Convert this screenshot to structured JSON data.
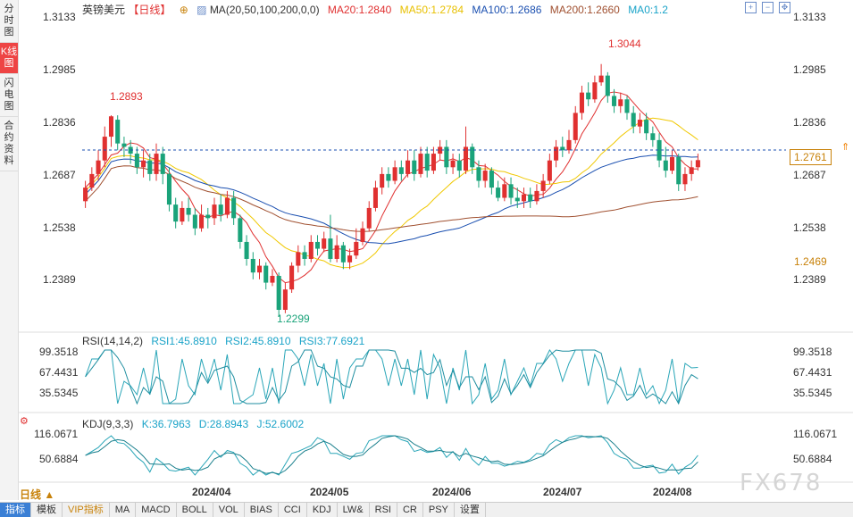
{
  "sidebar": {
    "tabs": [
      "分时图",
      "K线图",
      "闪电图",
      "合约资料"
    ],
    "active": 1
  },
  "header": {
    "symbol": "英镑美元",
    "period": "【日线】",
    "ma_def": "MA(20,50,100,200,0,0)",
    "ma20": "MA20:1.2840",
    "ma50": "MA50:1.2784",
    "ma100": "MA100:1.2686",
    "ma200": "MA200:1.2660",
    "ma0": "MA0:1.2"
  },
  "price_axis": [
    "1.3133",
    "1.2985",
    "1.2836",
    "1.2687",
    "1.2538",
    "1.2389"
  ],
  "price_boxes": {
    "current": "1.2761",
    "ma_level": "1.2469"
  },
  "annotations": {
    "high1": "1.2893",
    "high2": "1.3044",
    "low": "1.2299"
  },
  "rsi": {
    "def": "RSI(14,14,2)",
    "rsi1": "RSI1:45.8910",
    "rsi2": "RSI2:45.8910",
    "rsi3": "RSI3:77.6921",
    "axis": [
      "99.3518",
      "67.4431",
      "35.5345"
    ]
  },
  "kdj": {
    "def": "KDJ(9,3,3)",
    "k": "K:36.7963",
    "d": "D:28.8943",
    "j": "J:52.6002",
    "axis": [
      "116.0671",
      "50.6884"
    ]
  },
  "dates": [
    "2024/04",
    "2024/05",
    "2024/06",
    "2024/07",
    "2024/08"
  ],
  "period_label": "日线 ▲",
  "bottom_tabs": [
    "指标",
    "模板",
    "VIP指标",
    "MA",
    "MACD",
    "BOLL",
    "VOL",
    "BIAS",
    "CCI",
    "KDJ",
    "LW&",
    "RSI",
    "CR",
    "PSY",
    "设置"
  ],
  "watermark": "FX678",
  "colors": {
    "up": "#e03030",
    "down": "#1aa37a",
    "ma20": "#e03030",
    "ma50": "#f0c800",
    "ma100": "#1a4fb0",
    "ma200": "#a05030"
  },
  "chart_data": {
    "type": "candlestick",
    "ylim": [
      1.227,
      1.318
    ],
    "candles": [
      [
        1.264,
        1.268,
        1.262,
        1.27
      ],
      [
        1.268,
        1.272,
        1.267,
        1.274
      ],
      [
        1.272,
        1.276,
        1.27,
        1.279
      ],
      [
        1.276,
        1.283,
        1.274,
        1.286
      ],
      [
        1.283,
        1.289,
        1.28,
        1.2893
      ],
      [
        1.288,
        1.281,
        1.279,
        1.2893
      ],
      [
        1.281,
        1.28,
        1.277,
        1.283
      ],
      [
        1.28,
        1.278,
        1.275,
        1.282
      ],
      [
        1.278,
        1.274,
        1.272,
        1.28
      ],
      [
        1.274,
        1.276,
        1.271,
        1.279
      ],
      [
        1.276,
        1.272,
        1.27,
        1.278
      ],
      [
        1.272,
        1.278,
        1.27,
        1.281
      ],
      [
        1.278,
        1.272,
        1.269,
        1.28
      ],
      [
        1.272,
        1.263,
        1.261,
        1.274
      ],
      [
        1.263,
        1.258,
        1.256,
        1.265
      ],
      [
        1.258,
        1.262,
        1.257,
        1.264
      ],
      [
        1.262,
        1.26,
        1.258,
        1.265
      ],
      [
        1.26,
        1.256,
        1.254,
        1.262
      ],
      [
        1.256,
        1.26,
        1.255,
        1.263
      ],
      [
        1.26,
        1.259,
        1.256,
        1.262
      ],
      [
        1.259,
        1.263,
        1.257,
        1.265
      ],
      [
        1.263,
        1.26,
        1.258,
        1.266
      ],
      [
        1.26,
        1.265,
        1.259,
        1.267
      ],
      [
        1.265,
        1.259,
        1.257,
        1.267
      ],
      [
        1.259,
        1.252,
        1.25,
        1.26
      ],
      [
        1.252,
        1.247,
        1.245,
        1.254
      ],
      [
        1.247,
        1.243,
        1.241,
        1.249
      ],
      [
        1.243,
        1.245,
        1.241,
        1.247
      ],
      [
        1.245,
        1.24,
        1.238,
        1.246
      ],
      [
        1.24,
        1.242,
        1.239,
        1.244
      ],
      [
        1.242,
        1.232,
        1.2299,
        1.243
      ],
      [
        1.232,
        1.238,
        1.231,
        1.24
      ],
      [
        1.238,
        1.245,
        1.237,
        1.246
      ],
      [
        1.245,
        1.249,
        1.243,
        1.251
      ],
      [
        1.249,
        1.247,
        1.245,
        1.251
      ],
      [
        1.247,
        1.252,
        1.246,
        1.254
      ],
      [
        1.252,
        1.25,
        1.248,
        1.254
      ],
      [
        1.25,
        1.253,
        1.249,
        1.255
      ],
      [
        1.253,
        1.247,
        1.246,
        1.26
      ],
      [
        1.247,
        1.251,
        1.246,
        1.254
      ],
      [
        1.251,
        1.246,
        1.244,
        1.252
      ],
      [
        1.246,
        1.248,
        1.244,
        1.25
      ],
      [
        1.248,
        1.252,
        1.247,
        1.256
      ],
      [
        1.252,
        1.256,
        1.251,
        1.258
      ],
      [
        1.256,
        1.262,
        1.255,
        1.264
      ],
      [
        1.262,
        1.268,
        1.261,
        1.27
      ],
      [
        1.268,
        1.272,
        1.266,
        1.274
      ],
      [
        1.272,
        1.27,
        1.268,
        1.274
      ],
      [
        1.27,
        1.274,
        1.269,
        1.276
      ],
      [
        1.274,
        1.272,
        1.27,
        1.276
      ],
      [
        1.272,
        1.276,
        1.271,
        1.279
      ],
      [
        1.276,
        1.272,
        1.27,
        1.279
      ],
      [
        1.272,
        1.278,
        1.271,
        1.28
      ],
      [
        1.278,
        1.273,
        1.271,
        1.28
      ],
      [
        1.273,
        1.278,
        1.272,
        1.28
      ],
      [
        1.278,
        1.28,
        1.276,
        1.282
      ],
      [
        1.28,
        1.274,
        1.272,
        1.282
      ],
      [
        1.274,
        1.276,
        1.272,
        1.278
      ],
      [
        1.276,
        1.273,
        1.271,
        1.278
      ],
      [
        1.273,
        1.28,
        1.272,
        1.286
      ],
      [
        1.28,
        1.274,
        1.272,
        1.281
      ],
      [
        1.274,
        1.27,
        1.268,
        1.276
      ],
      [
        1.27,
        1.273,
        1.268,
        1.275
      ],
      [
        1.273,
        1.268,
        1.266,
        1.274
      ],
      [
        1.268,
        1.265,
        1.264,
        1.27
      ],
      [
        1.265,
        1.269,
        1.264,
        1.271
      ],
      [
        1.269,
        1.265,
        1.263,
        1.271
      ],
      [
        1.265,
        1.264,
        1.262,
        1.268
      ],
      [
        1.264,
        1.266,
        1.262,
        1.268
      ],
      [
        1.266,
        1.264,
        1.262,
        1.268
      ],
      [
        1.264,
        1.267,
        1.263,
        1.269
      ],
      [
        1.267,
        1.27,
        1.265,
        1.272
      ],
      [
        1.27,
        1.276,
        1.269,
        1.278
      ],
      [
        1.276,
        1.28,
        1.274,
        1.282
      ],
      [
        1.28,
        1.279,
        1.277,
        1.283
      ],
      [
        1.279,
        1.282,
        1.278,
        1.285
      ],
      [
        1.282,
        1.29,
        1.281,
        1.292
      ],
      [
        1.29,
        1.296,
        1.288,
        1.298
      ],
      [
        1.296,
        1.294,
        1.292,
        1.299
      ],
      [
        1.294,
        1.299,
        1.293,
        1.301
      ],
      [
        1.299,
        1.301,
        1.298,
        1.3044
      ],
      [
        1.301,
        1.295,
        1.293,
        1.302
      ],
      [
        1.295,
        1.292,
        1.29,
        1.297
      ],
      [
        1.292,
        1.294,
        1.29,
        1.296
      ],
      [
        1.294,
        1.29,
        1.288,
        1.295
      ],
      [
        1.29,
        1.286,
        1.284,
        1.292
      ],
      [
        1.286,
        1.288,
        1.284,
        1.29
      ],
      [
        1.288,
        1.284,
        1.282,
        1.29
      ],
      [
        1.284,
        1.282,
        1.28,
        1.286
      ],
      [
        1.282,
        1.276,
        1.274,
        1.284
      ],
      [
        1.276,
        1.273,
        1.271,
        1.28
      ],
      [
        1.273,
        1.277,
        1.272,
        1.279
      ],
      [
        1.277,
        1.269,
        1.267,
        1.278
      ],
      [
        1.269,
        1.272,
        1.267,
        1.274
      ],
      [
        1.272,
        1.274,
        1.27,
        1.276
      ],
      [
        1.274,
        1.2761,
        1.273,
        1.278
      ]
    ]
  }
}
